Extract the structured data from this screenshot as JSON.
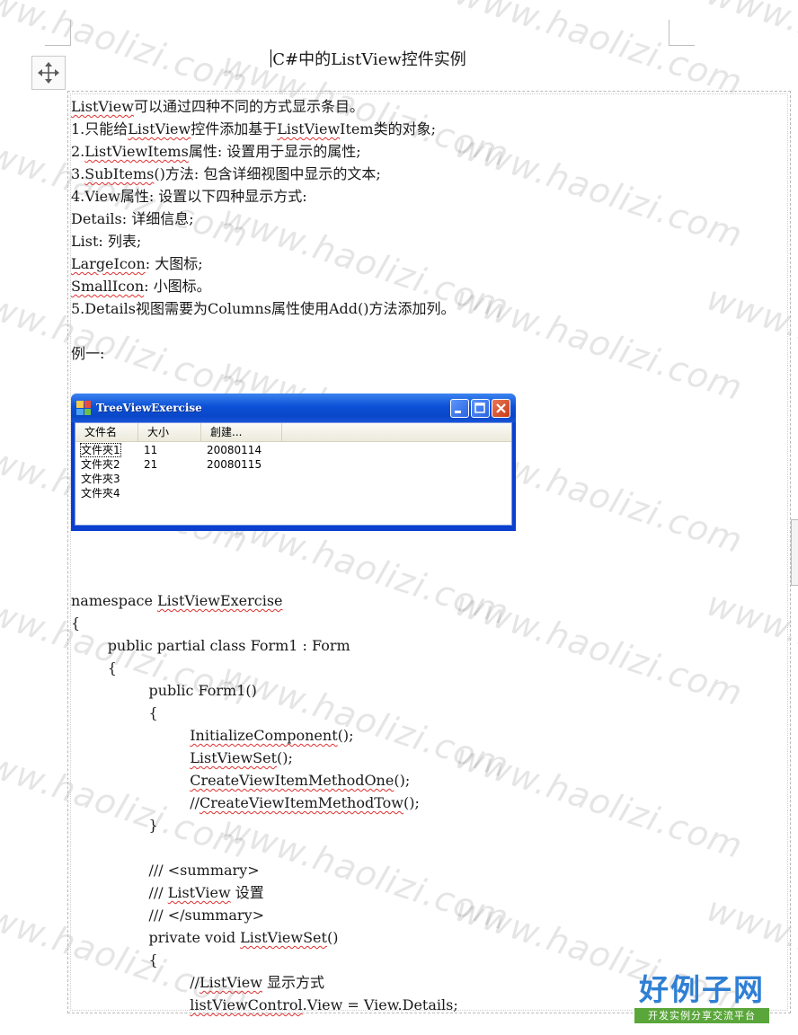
{
  "watermark": {
    "text": "www.haolizi.com"
  },
  "document": {
    "title": "C#中的ListView控件实例",
    "paragraphs": [
      {
        "text": "ListView可以通过四种不同的方式显示条目。",
        "spell": [
          [
            "ListView"
          ]
        ]
      },
      {
        "text": "1.只能给ListView控件添加基于ListViewItem类的对象;"
      },
      {
        "text": "2.ListViewItems属性: 设置用于显示的属性;"
      },
      {
        "text": "3.SubItems()方法: 包含详细视图中显示的文本;"
      },
      {
        "text": "4.View属性: 设置以下四种显示方式:"
      },
      {
        "text": "Details: 详细信息;"
      },
      {
        "text": "List: 列表;"
      },
      {
        "text": "LargeIcon: 大图标;"
      },
      {
        "text": "SmallIcon: 小图标。"
      },
      {
        "text": "5.Details视图需要为Columns属性使用Add()方法添加列。"
      },
      {
        "text": ""
      },
      {
        "text": "例一:"
      }
    ],
    "code_lines": [
      "namespace ListViewExercise",
      "{",
      "        public partial class Form1 : Form",
      "        {",
      "                 public Form1()",
      "                 {",
      "                          InitializeComponent();",
      "                          ListViewSet();",
      "                          CreateViewItemMethodOne();",
      "                          //CreateViewItemMethodTow();",
      "                 }",
      "",
      "                 /// <summary>",
      "                 /// ListView 设置",
      "                 /// </summary>",
      "                 private void ListViewSet()",
      "                 {",
      "                          //ListView 显示方式",
      "                          listViewControl.View = View.Details;"
    ]
  },
  "embedded_window": {
    "title": "TreeViewExercise",
    "columns": [
      "文件名",
      "大小",
      "創建..."
    ],
    "rows": [
      [
        "文件夾1",
        "11",
        "20080114"
      ],
      [
        "文件夾2",
        "21",
        "20080115"
      ],
      [
        "文件夾3",
        "",
        ""
      ],
      [
        "文件夾4",
        "",
        ""
      ]
    ]
  },
  "logo": {
    "main": "好例子网",
    "sub": "开发实例分享交流平台"
  },
  "colors": {
    "spell_underline": "#e03030",
    "xp_blue": "#0a3fcf",
    "logo_blue": "#2f7fd4",
    "logo_green": "#5aa63a"
  },
  "icons": {
    "move": "move-arrows-icon",
    "app": "window-app-icon",
    "minimize": "minimize-icon",
    "maximize": "maximize-icon",
    "close": "close-icon"
  }
}
